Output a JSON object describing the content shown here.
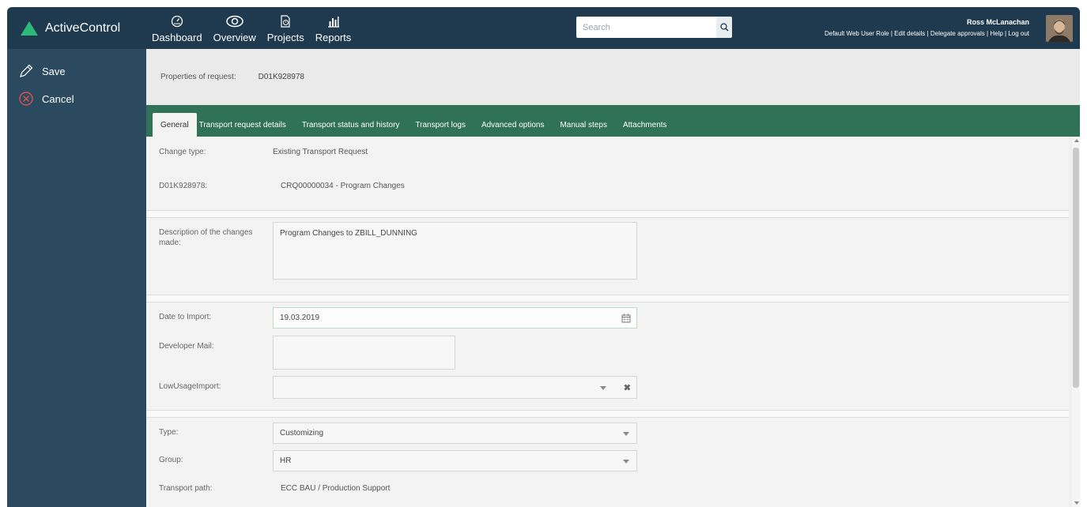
{
  "brand": {
    "name": "ActiveControl",
    "color": "#2eb87a"
  },
  "nav": [
    {
      "label": "Dashboard",
      "icon": "gauge-icon"
    },
    {
      "label": "Overview",
      "icon": "eye-icon"
    },
    {
      "label": "Projects",
      "icon": "document-clock-icon"
    },
    {
      "label": "Reports",
      "icon": "bar-chart-icon"
    }
  ],
  "search": {
    "placeholder": "Search",
    "icon": "search-icon"
  },
  "user": {
    "name": "Ross McLanachan",
    "links": [
      "Default Web User Role",
      "Edit details",
      "Delegate approvals",
      "Help",
      "Log out"
    ]
  },
  "sidebar": {
    "save_label": "Save",
    "cancel_label": "Cancel"
  },
  "properties": {
    "label": "Properties of request:",
    "value": "D01K928978"
  },
  "tabs": [
    "General",
    "Transport request details",
    "Transport status and history",
    "Transport logs",
    "Advanced options",
    "Manual steps",
    "Attachments"
  ],
  "active_tab": "General",
  "form": {
    "change_type": {
      "label": "Change type:",
      "value": "Existing Transport Request"
    },
    "request": {
      "label": "D01K928978:",
      "value": "CRQ00000034 - Program Changes"
    },
    "description": {
      "label": "Description of the changes made:",
      "value": "Program Changes to ZBILL_DUNNING"
    },
    "date_import": {
      "label": "Date to Import:",
      "value": "19.03.2019"
    },
    "developer_mail": {
      "label": "Developer Mail:",
      "value": ""
    },
    "low_usage": {
      "label": "LowUsageImport:",
      "value": ""
    },
    "type": {
      "label": "Type:",
      "value": "Customizing"
    },
    "group": {
      "label": "Group:",
      "value": "HR"
    },
    "transport_path": {
      "label": "Transport path:",
      "value": "ECC BAU / Production Support"
    }
  },
  "colors": {
    "topbar": "#1f3a4f",
    "sidebar": "#2c4a5f",
    "tabbar": "#2f7257",
    "cancel": "#d9534f"
  }
}
